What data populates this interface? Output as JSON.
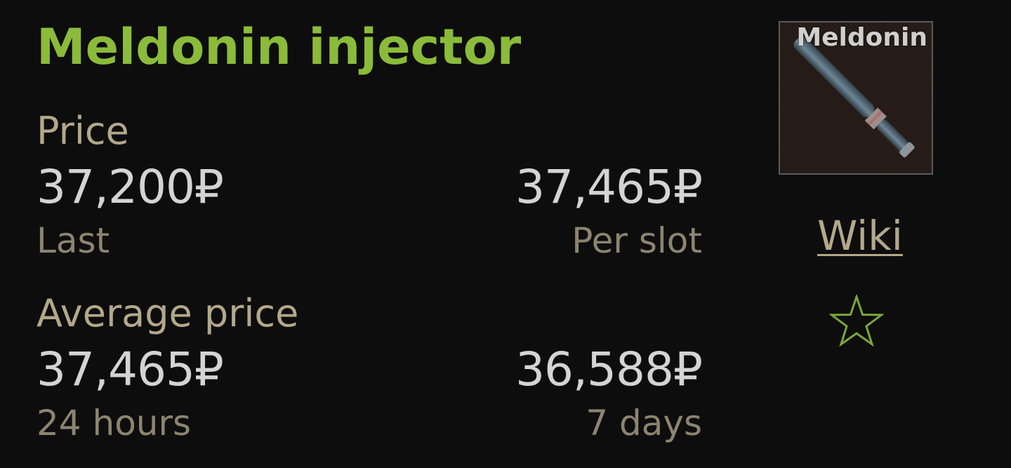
{
  "item": {
    "title": "Meldonin injector",
    "thumbnail_label": "Meldonin",
    "wiki_label": "Wiki",
    "favorite_icon": "star-outline-icon"
  },
  "price": {
    "label": "Price",
    "last_value": "37,200₽",
    "last_label": "Last",
    "per_slot_value": "37,465₽",
    "per_slot_label": "Per slot"
  },
  "average": {
    "label": "Average price",
    "day_value": "37,465₽",
    "day_label": "24 hours",
    "week_value": "36,588₽",
    "week_label": "7 days"
  },
  "colors": {
    "title": "#8bbb3a",
    "label": "#b3a88a",
    "value": "#d4d4d4",
    "sublabel": "#8d8470",
    "star": "#7aa83a",
    "background": "#0d0d0d"
  }
}
